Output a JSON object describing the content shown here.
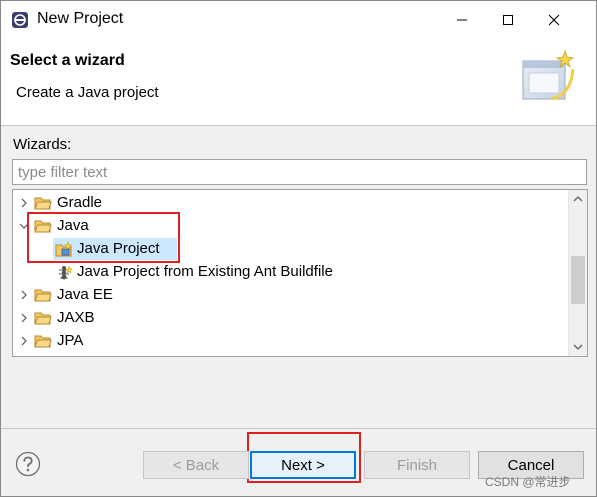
{
  "window": {
    "title": "New Project"
  },
  "banner": {
    "title": "Select a wizard",
    "subtitle": "Create a Java project"
  },
  "wizards": {
    "label": "Wizards:",
    "filter_placeholder": "type filter text",
    "tree": {
      "gradle": "Gradle",
      "java": "Java",
      "java_project": "Java Project",
      "java_project_ant": "Java Project from Existing Ant Buildfile",
      "java_ee": "Java EE",
      "jaxb": "JAXB",
      "jpa": "JPA"
    },
    "selected_item": "Java Project"
  },
  "buttons": {
    "help": "?",
    "back": "< Back",
    "next": "Next >",
    "finish": "Finish",
    "cancel": "Cancel"
  },
  "watermark": "CSDN @常进步",
  "colors": {
    "selection": "#cce8ff",
    "highlight_box": "#e02020",
    "default_button": "#0078d7"
  }
}
